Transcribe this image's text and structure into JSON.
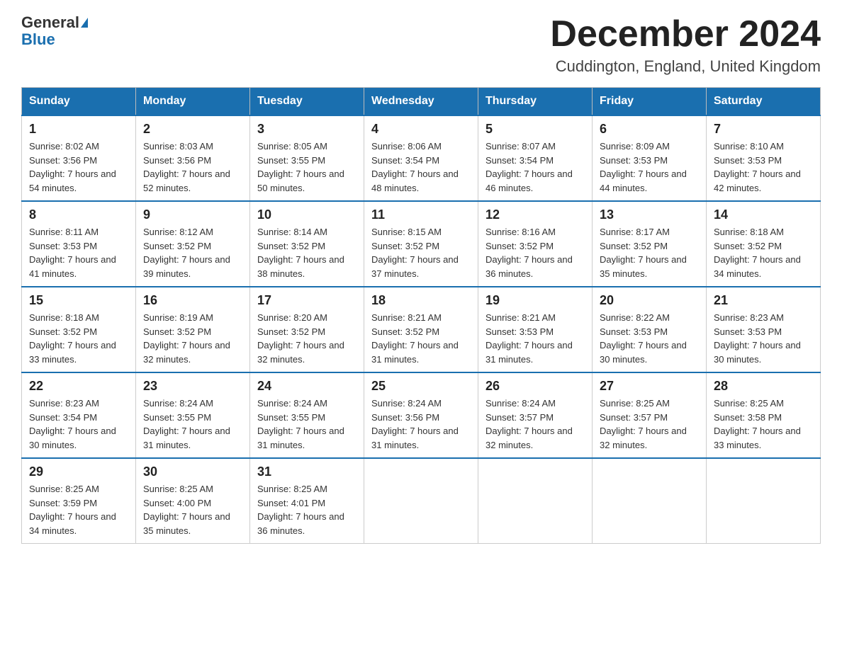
{
  "logo": {
    "general": "General",
    "blue": "Blue"
  },
  "header": {
    "month": "December 2024",
    "location": "Cuddington, England, United Kingdom"
  },
  "days_of_week": [
    "Sunday",
    "Monday",
    "Tuesday",
    "Wednesday",
    "Thursday",
    "Friday",
    "Saturday"
  ],
  "weeks": [
    [
      {
        "day": "1",
        "sunrise": "8:02 AM",
        "sunset": "3:56 PM",
        "daylight": "7 hours and 54 minutes."
      },
      {
        "day": "2",
        "sunrise": "8:03 AM",
        "sunset": "3:56 PM",
        "daylight": "7 hours and 52 minutes."
      },
      {
        "day": "3",
        "sunrise": "8:05 AM",
        "sunset": "3:55 PM",
        "daylight": "7 hours and 50 minutes."
      },
      {
        "day": "4",
        "sunrise": "8:06 AM",
        "sunset": "3:54 PM",
        "daylight": "7 hours and 48 minutes."
      },
      {
        "day": "5",
        "sunrise": "8:07 AM",
        "sunset": "3:54 PM",
        "daylight": "7 hours and 46 minutes."
      },
      {
        "day": "6",
        "sunrise": "8:09 AM",
        "sunset": "3:53 PM",
        "daylight": "7 hours and 44 minutes."
      },
      {
        "day": "7",
        "sunrise": "8:10 AM",
        "sunset": "3:53 PM",
        "daylight": "7 hours and 42 minutes."
      }
    ],
    [
      {
        "day": "8",
        "sunrise": "8:11 AM",
        "sunset": "3:53 PM",
        "daylight": "7 hours and 41 minutes."
      },
      {
        "day": "9",
        "sunrise": "8:12 AM",
        "sunset": "3:52 PM",
        "daylight": "7 hours and 39 minutes."
      },
      {
        "day": "10",
        "sunrise": "8:14 AM",
        "sunset": "3:52 PM",
        "daylight": "7 hours and 38 minutes."
      },
      {
        "day": "11",
        "sunrise": "8:15 AM",
        "sunset": "3:52 PM",
        "daylight": "7 hours and 37 minutes."
      },
      {
        "day": "12",
        "sunrise": "8:16 AM",
        "sunset": "3:52 PM",
        "daylight": "7 hours and 36 minutes."
      },
      {
        "day": "13",
        "sunrise": "8:17 AM",
        "sunset": "3:52 PM",
        "daylight": "7 hours and 35 minutes."
      },
      {
        "day": "14",
        "sunrise": "8:18 AM",
        "sunset": "3:52 PM",
        "daylight": "7 hours and 34 minutes."
      }
    ],
    [
      {
        "day": "15",
        "sunrise": "8:18 AM",
        "sunset": "3:52 PM",
        "daylight": "7 hours and 33 minutes."
      },
      {
        "day": "16",
        "sunrise": "8:19 AM",
        "sunset": "3:52 PM",
        "daylight": "7 hours and 32 minutes."
      },
      {
        "day": "17",
        "sunrise": "8:20 AM",
        "sunset": "3:52 PM",
        "daylight": "7 hours and 32 minutes."
      },
      {
        "day": "18",
        "sunrise": "8:21 AM",
        "sunset": "3:52 PM",
        "daylight": "7 hours and 31 minutes."
      },
      {
        "day": "19",
        "sunrise": "8:21 AM",
        "sunset": "3:53 PM",
        "daylight": "7 hours and 31 minutes."
      },
      {
        "day": "20",
        "sunrise": "8:22 AM",
        "sunset": "3:53 PM",
        "daylight": "7 hours and 30 minutes."
      },
      {
        "day": "21",
        "sunrise": "8:23 AM",
        "sunset": "3:53 PM",
        "daylight": "7 hours and 30 minutes."
      }
    ],
    [
      {
        "day": "22",
        "sunrise": "8:23 AM",
        "sunset": "3:54 PM",
        "daylight": "7 hours and 30 minutes."
      },
      {
        "day": "23",
        "sunrise": "8:24 AM",
        "sunset": "3:55 PM",
        "daylight": "7 hours and 31 minutes."
      },
      {
        "day": "24",
        "sunrise": "8:24 AM",
        "sunset": "3:55 PM",
        "daylight": "7 hours and 31 minutes."
      },
      {
        "day": "25",
        "sunrise": "8:24 AM",
        "sunset": "3:56 PM",
        "daylight": "7 hours and 31 minutes."
      },
      {
        "day": "26",
        "sunrise": "8:24 AM",
        "sunset": "3:57 PM",
        "daylight": "7 hours and 32 minutes."
      },
      {
        "day": "27",
        "sunrise": "8:25 AM",
        "sunset": "3:57 PM",
        "daylight": "7 hours and 32 minutes."
      },
      {
        "day": "28",
        "sunrise": "8:25 AM",
        "sunset": "3:58 PM",
        "daylight": "7 hours and 33 minutes."
      }
    ],
    [
      {
        "day": "29",
        "sunrise": "8:25 AM",
        "sunset": "3:59 PM",
        "daylight": "7 hours and 34 minutes."
      },
      {
        "day": "30",
        "sunrise": "8:25 AM",
        "sunset": "4:00 PM",
        "daylight": "7 hours and 35 minutes."
      },
      {
        "day": "31",
        "sunrise": "8:25 AM",
        "sunset": "4:01 PM",
        "daylight": "7 hours and 36 minutes."
      },
      null,
      null,
      null,
      null
    ]
  ]
}
